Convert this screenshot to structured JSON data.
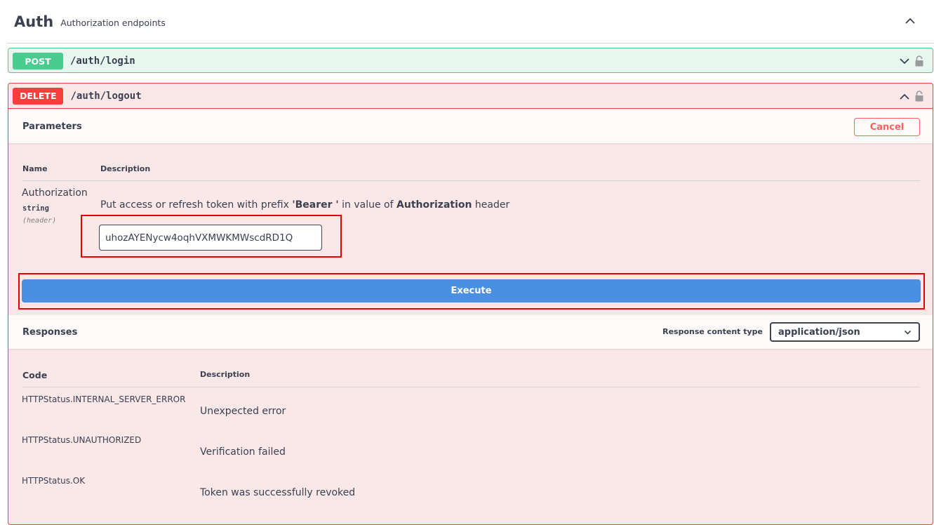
{
  "tag": {
    "name": "Auth",
    "description": "Authorization endpoints"
  },
  "operations": [
    {
      "method": "POST",
      "path": "/auth/login",
      "color": "#49cc90",
      "expanded": false
    },
    {
      "method": "DELETE",
      "path": "/auth/logout",
      "color": "#f93e3e",
      "expanded": true
    }
  ],
  "parameters": {
    "title": "Parameters",
    "cancel_label": "Cancel",
    "col_name": "Name",
    "col_description": "Description",
    "items": [
      {
        "name": "Authorization",
        "type": "string",
        "in": "(header)",
        "desc_pre": "Put access or refresh token with prefix ",
        "desc_bold1": "'Bearer '",
        "desc_mid": " in value of ",
        "desc_bold2": "Authorization",
        "desc_post": " header",
        "value": "uhozAYENycw4oqhVXMWKMWscdRD1Q"
      }
    ]
  },
  "execute_label": "Execute",
  "responses": {
    "title": "Responses",
    "content_type_label": "Response content type",
    "content_type_value": "application/json",
    "col_code": "Code",
    "col_description": "Description",
    "items": [
      {
        "code": "HTTPStatus.INTERNAL_SERVER_ERROR",
        "description": "Unexpected error"
      },
      {
        "code": "HTTPStatus.UNAUTHORIZED",
        "description": "Verification failed"
      },
      {
        "code": "HTTPStatus.OK",
        "description": "Token was successfully revoked"
      }
    ]
  },
  "icons": {
    "tag_toggle": "chevron-up-icon",
    "collapsed_toggle": "chevron-down-icon",
    "expanded_toggle": "chevron-up-icon",
    "auth": "lock-icon",
    "select_arrow": "chevron-down-icon"
  },
  "colors": {
    "post": "#49cc90",
    "delete": "#f93e3e",
    "execute": "#4990e2",
    "highlight": "#e50000"
  }
}
